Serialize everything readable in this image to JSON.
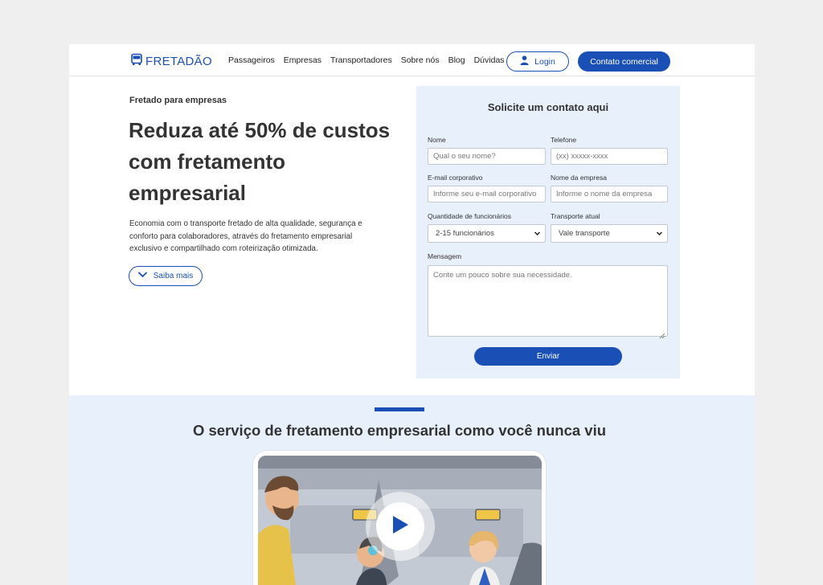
{
  "header": {
    "logo_text": "FRETADÃO",
    "logo_icon": "bus-icon",
    "nav": [
      "Passageiros",
      "Empresas",
      "Transportadores",
      "Sobre nós",
      "Blog",
      "Dúvidas"
    ],
    "login_label": "Login",
    "contact_label": "Contato comercial"
  },
  "hero": {
    "eyebrow": "Fretado para empresas",
    "title": "Reduza até 50% de custos com fretamento empresarial",
    "description": "Economia com o transporte fretado de alta qualidade, segurança e conforto para colaboradores, através do fretamento empresarial exclusivo e compartilhado com roteirização otimizada.",
    "more_label": "Saiba mais"
  },
  "form": {
    "title": "Solicite um contato aqui",
    "name_label": "Nome",
    "name_placeholder": "Qual o seu nome?",
    "phone_label": "Telefone",
    "phone_placeholder": "(xx) xxxxx-xxxx",
    "email_label": "E-mail corporativo",
    "email_placeholder": "Informe seu e-mail corporativo",
    "company_label": "Nome da empresa",
    "company_placeholder": "Informe o nome da empresa",
    "employees_label": "Quantidade de funcionários",
    "employees_value": "2-15 funcionários",
    "transport_label": "Transporte atual",
    "transport_value": "Vale transporte",
    "message_label": "Mensagem",
    "message_placeholder": "Conte um pouco sobre sua necessidade.",
    "submit_label": "Enviar"
  },
  "section2": {
    "title": "O serviço de fretamento empresarial como você nunca viu"
  },
  "colors": {
    "brand": "#1a4fb5",
    "form_bg": "#e8f0fc",
    "page_bg": "#efefef"
  }
}
